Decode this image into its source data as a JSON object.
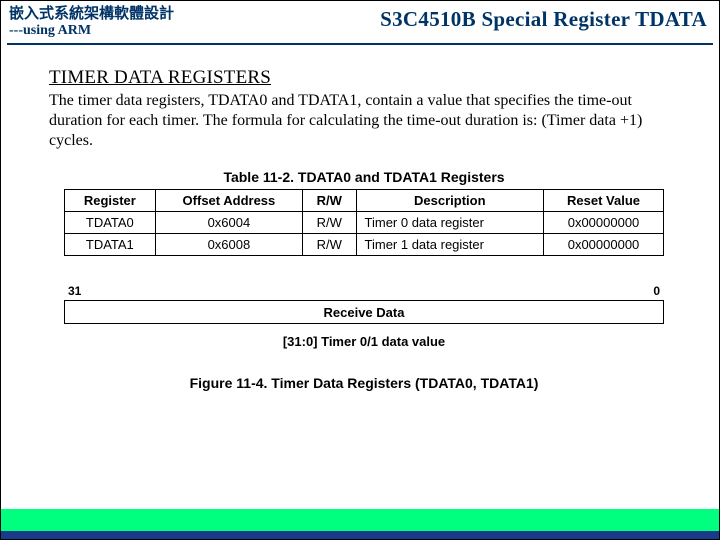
{
  "header": {
    "left_line1": "嵌入式系統架構軟體設計",
    "left_line2": "---using ARM",
    "right": "S3C4510B Special Register TDATA"
  },
  "section": {
    "heading": "TIMER DATA REGISTERS",
    "paragraph": "The timer data registers, TDATA0 and TDATA1, contain a value that specifies the time-out duration for each timer. The formula for calculating the time-out duration is: (Timer data +1) cycles."
  },
  "table": {
    "caption": "Table 11-2. TDATA0 and TDATA1 Registers",
    "headers": [
      "Register",
      "Offset Address",
      "R/W",
      "Description",
      "Reset Value"
    ],
    "rows": [
      {
        "register": "TDATA0",
        "offset": "0x6004",
        "rw": "R/W",
        "desc": "Timer 0 data register",
        "reset": "0x00000000"
      },
      {
        "register": "TDATA1",
        "offset": "0x6008",
        "rw": "R/W",
        "desc": "Timer 1 data register",
        "reset": "0x00000000"
      }
    ]
  },
  "bitfield": {
    "msb": "31",
    "lsb": "0",
    "box_label": "Receive Data",
    "note": "[31:0] Timer 0/1 data  value"
  },
  "figure_caption": "Figure 11-4. Timer Data Registers (TDATA0, TDATA1)"
}
